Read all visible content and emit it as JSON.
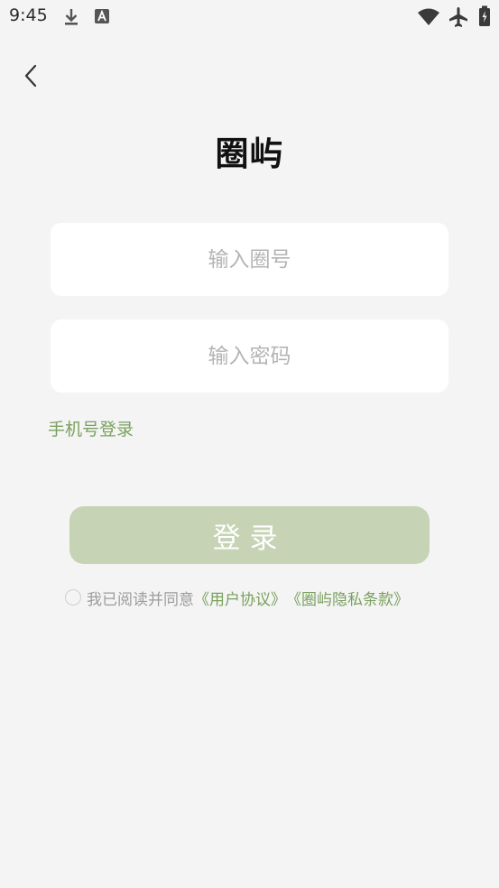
{
  "status_bar": {
    "time": "9:45",
    "icons": [
      "download-icon",
      "font-a-icon",
      "wifi-icon",
      "airplane-mode-icon",
      "battery-icon"
    ]
  },
  "nav": {
    "back_icon": "back-chevron-icon"
  },
  "app": {
    "title": "圈屿"
  },
  "form": {
    "circle_id_placeholder": "输入圈号",
    "password_placeholder": "输入密码",
    "circle_id_value": "",
    "password_value": "",
    "phone_login_label": "手机号登录",
    "login_button_label": "登录"
  },
  "agreement": {
    "checked": false,
    "prefix_text": "我已阅读并同意",
    "user_agreement_link": "《用户协议》",
    "privacy_link": "《圈屿隐私条款》"
  },
  "colors": {
    "background": "#f4f4f4",
    "accent_green": "#7aa05e",
    "login_button_bg": "#c6d3b4",
    "input_bg": "#ffffff",
    "placeholder_gray": "#b4b4b4"
  }
}
